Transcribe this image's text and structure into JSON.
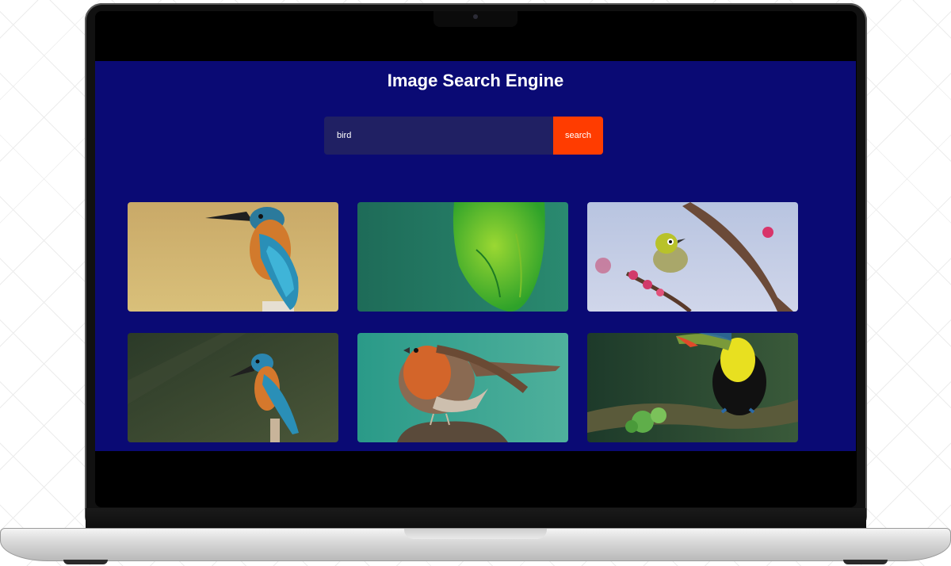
{
  "page": {
    "title": "Image Search Engine"
  },
  "search": {
    "value": "bird",
    "button_label": "search"
  },
  "results": [
    {
      "subject": "kingfisher-on-branch"
    },
    {
      "subject": "green-bird-closeup"
    },
    {
      "subject": "white-eye-on-blossom-branch"
    },
    {
      "subject": "kingfisher-perched"
    },
    {
      "subject": "robin-on-stump"
    },
    {
      "subject": "toucan-on-mossy-branch"
    }
  ],
  "colors": {
    "page_background": "#0a0a74",
    "input_background": "#202063",
    "button_background": "#ff3c00",
    "text": "#ffffff"
  }
}
